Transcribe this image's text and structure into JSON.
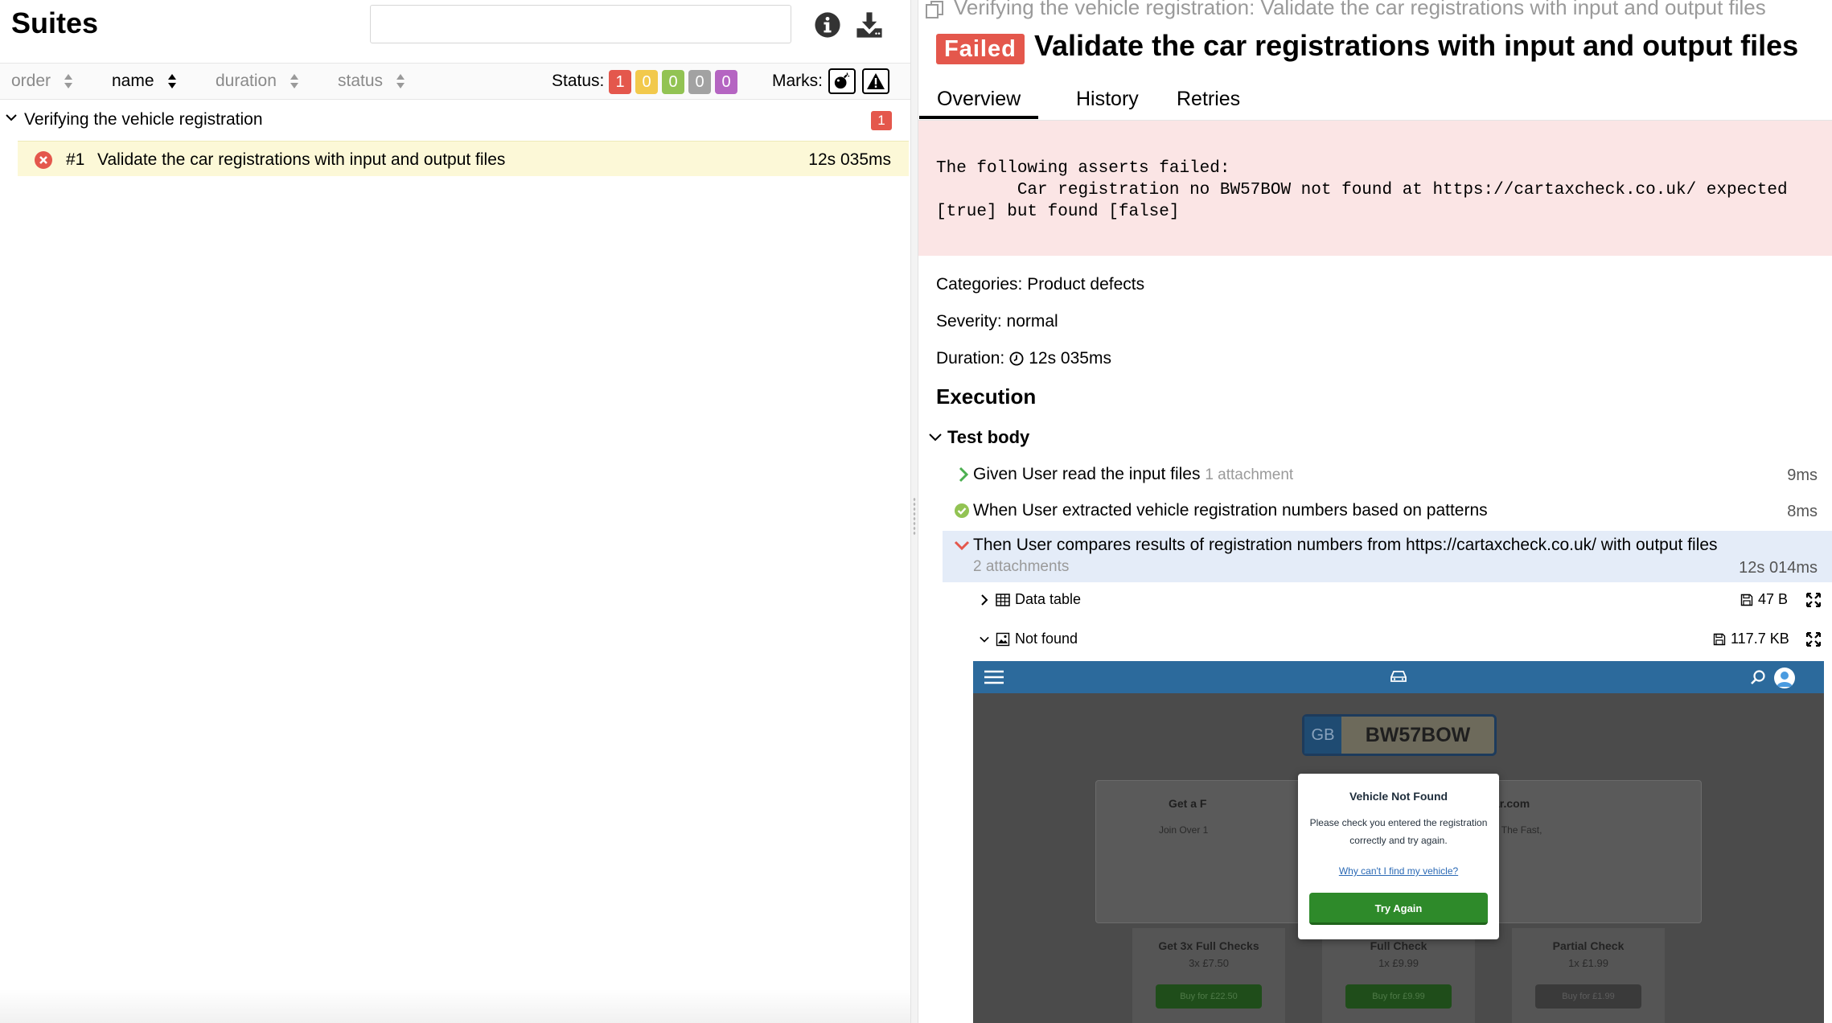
{
  "suites": {
    "title": "Suites",
    "search_placeholder": "",
    "sorters": [
      {
        "label": "order",
        "active": false
      },
      {
        "label": "name",
        "active": true
      },
      {
        "label": "duration",
        "active": false
      },
      {
        "label": "status",
        "active": false
      }
    ],
    "status_label": "Status:",
    "status_counts": [
      {
        "value": "1",
        "color": "#e4574c"
      },
      {
        "value": "0",
        "color": "#f2c94c"
      },
      {
        "value": "0",
        "color": "#92c353"
      },
      {
        "value": "0",
        "color": "#a2a2a2"
      },
      {
        "value": "0",
        "color": "#b565c2"
      }
    ],
    "marks_label": "Marks:",
    "group": {
      "name": "Verifying the vehicle registration",
      "count": "1"
    },
    "test": {
      "index": "#1",
      "name": "Validate the car registrations with input and output files",
      "duration": "12s 035ms"
    }
  },
  "detail": {
    "breadcrumb": "Verifying the vehicle registration: Validate the car registrations with input and output files",
    "status_badge": "Failed",
    "title": "Validate the car registrations with input and output files",
    "tabs": [
      "Overview",
      "History",
      "Retries"
    ],
    "error": "The following asserts failed:\n\tCar registration no BW57BOW not found at https://cartaxcheck.co.uk/ expected [true] but found [false]",
    "categories": "Categories: Product defects",
    "severity": "Severity: normal",
    "duration_label": "Duration:",
    "duration_value": "12s 035ms",
    "execution_heading": "Execution",
    "test_body_label": "Test body",
    "steps": [
      {
        "text": "Given User read the input files",
        "sub": "1 attachment",
        "duration": "9ms"
      },
      {
        "text": "When User extracted vehicle registration numbers based on patterns",
        "sub": "",
        "duration": "8ms"
      },
      {
        "text": "Then User compares results of registration numbers from https://cartaxcheck.co.uk/ with output files",
        "sub": "2 attachments",
        "duration": "12s 014ms"
      }
    ],
    "attachments": [
      {
        "name": "Data table",
        "size": "47 B"
      },
      {
        "name": "Not found",
        "size": "117.7 KB"
      }
    ]
  },
  "screenshot": {
    "plate_country": "GB",
    "plate_reg": "BW57BOW",
    "card_left_title": "Get a F",
    "card_left_sub": "Join Over 1",
    "card_right_title": "ar.com",
    "card_right_sub": "g The Fast,",
    "modal_title": "Vehicle Not Found",
    "modal_message": "Please check you entered the registration correctly and try again.",
    "modal_link": "Why can't I find my vehicle?",
    "modal_button": "Try Again",
    "prices": [
      {
        "title": "Get 3x Full Checks",
        "price": "3x £7.50",
        "button": "Buy for £22.50"
      },
      {
        "title": "Full Check",
        "price": "1x £9.99",
        "button": "Buy for £9.99"
      },
      {
        "title": "Partial Check",
        "price": "1x £1.99",
        "button": "Buy for £1.99"
      }
    ]
  },
  "colors": {
    "failed": "#e4574c",
    "passed": "#92c353",
    "error_bg": "#fbe5e5",
    "selected_row": "#fcf8d7",
    "active_step": "#e4ecf8"
  },
  "icons": {
    "info": "info-icon",
    "download": "download-icon",
    "flaky": "bomb-icon",
    "known": "warning-icon",
    "failed": "x-circle-icon",
    "passed": "check-circle-icon",
    "clock": "clock-icon"
  }
}
